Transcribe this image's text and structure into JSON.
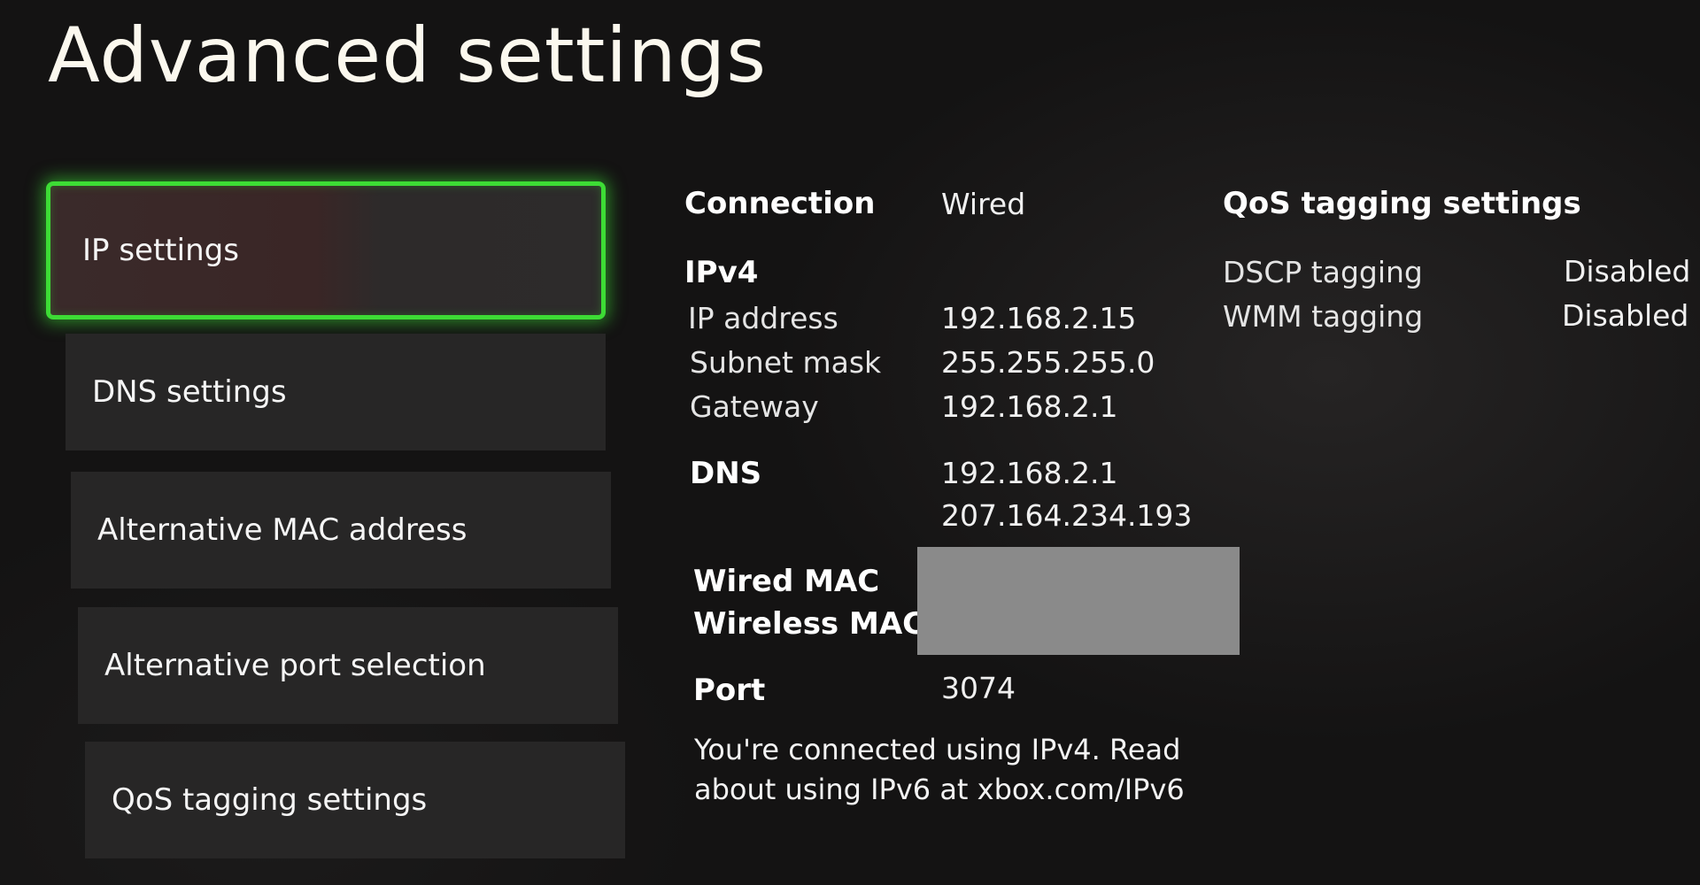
{
  "page": {
    "title": "Advanced settings"
  },
  "menu": {
    "items": [
      {
        "label": "IP settings"
      },
      {
        "label": "DNS settings"
      },
      {
        "label": "Alternative MAC address"
      },
      {
        "label": "Alternative port selection"
      },
      {
        "label": "QoS tagging settings"
      }
    ]
  },
  "details": {
    "connection_label": "Connection",
    "connection_value": "Wired",
    "ipv4_label": "IPv4",
    "ip_address_label": "IP address",
    "ip_address_value": "192.168.2.15",
    "subnet_label": "Subnet mask",
    "subnet_value": "255.255.255.0",
    "gateway_label": "Gateway",
    "gateway_value": "192.168.2.1",
    "dns_label": "DNS",
    "dns_primary": "192.168.2.1",
    "dns_secondary": "207.164.234.193",
    "wired_mac_label": "Wired MAC",
    "wireless_mac_label": "Wireless MAC",
    "port_label": "Port",
    "port_value": "3074",
    "note": "You're connected using IPv4. Read about using IPv6 at xbox.com/IPv6"
  },
  "qos": {
    "heading": "QoS tagging settings",
    "dscp_label": "DSCP tagging",
    "dscp_value": "Disabled",
    "wmm_label": "WMM tagging",
    "wmm_value": "Disabled"
  },
  "colors": {
    "focus_accent": "#3ddc35",
    "background": "#141313",
    "redaction": "#8a8a8a"
  }
}
